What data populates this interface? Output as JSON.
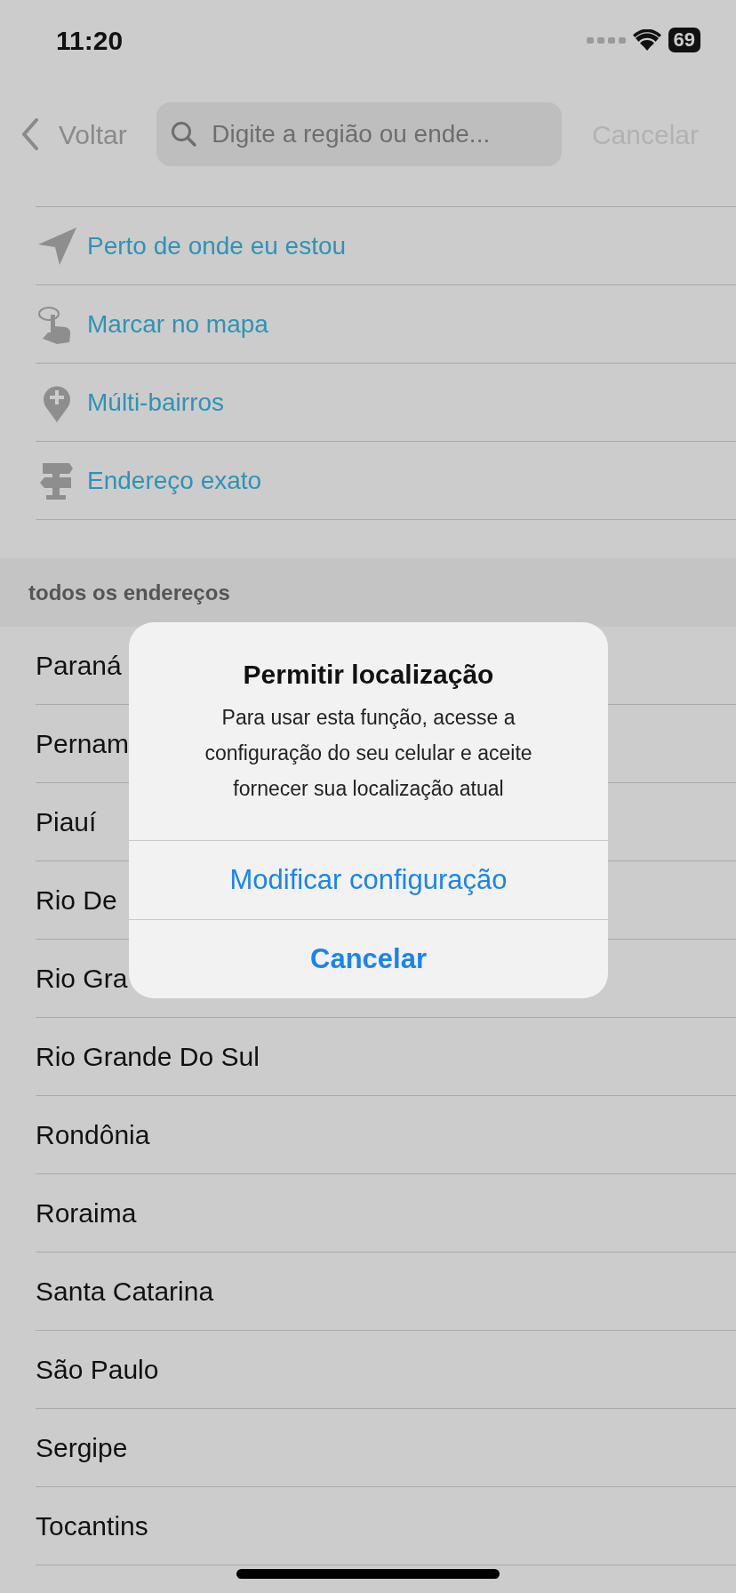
{
  "status_bar": {
    "time": "11:20",
    "battery": "69"
  },
  "nav": {
    "back": "Voltar",
    "search": {
      "placeholder": "Digite a região ou ende..."
    },
    "cancel": "Cancelar"
  },
  "options": [
    {
      "kind": "location",
      "label": "Perto de onde eu estou"
    },
    {
      "kind": "tap",
      "label": "Marcar no mapa"
    },
    {
      "kind": "pin",
      "label": "Múlti-bairros"
    },
    {
      "kind": "signpost",
      "label": "Endereço exato"
    }
  ],
  "section": {
    "title": "todos os endereços"
  },
  "states": [
    "Paraná",
    "Pernam",
    "Piauí",
    "Rio De",
    "Rio Gra",
    "Rio Grande Do Sul",
    "Rondônia",
    "Roraima",
    "Santa Catarina",
    "São Paulo",
    "Sergipe",
    "Tocantins"
  ],
  "alert": {
    "title": "Permitir localização",
    "message": "Para usar esta função, acesse a configuração do seu celular e aceite fornecer sua localização atual",
    "buttons": [
      {
        "label": "Modificar configuração",
        "bold": false
      },
      {
        "label": "Cancelar",
        "bold": true
      }
    ]
  }
}
